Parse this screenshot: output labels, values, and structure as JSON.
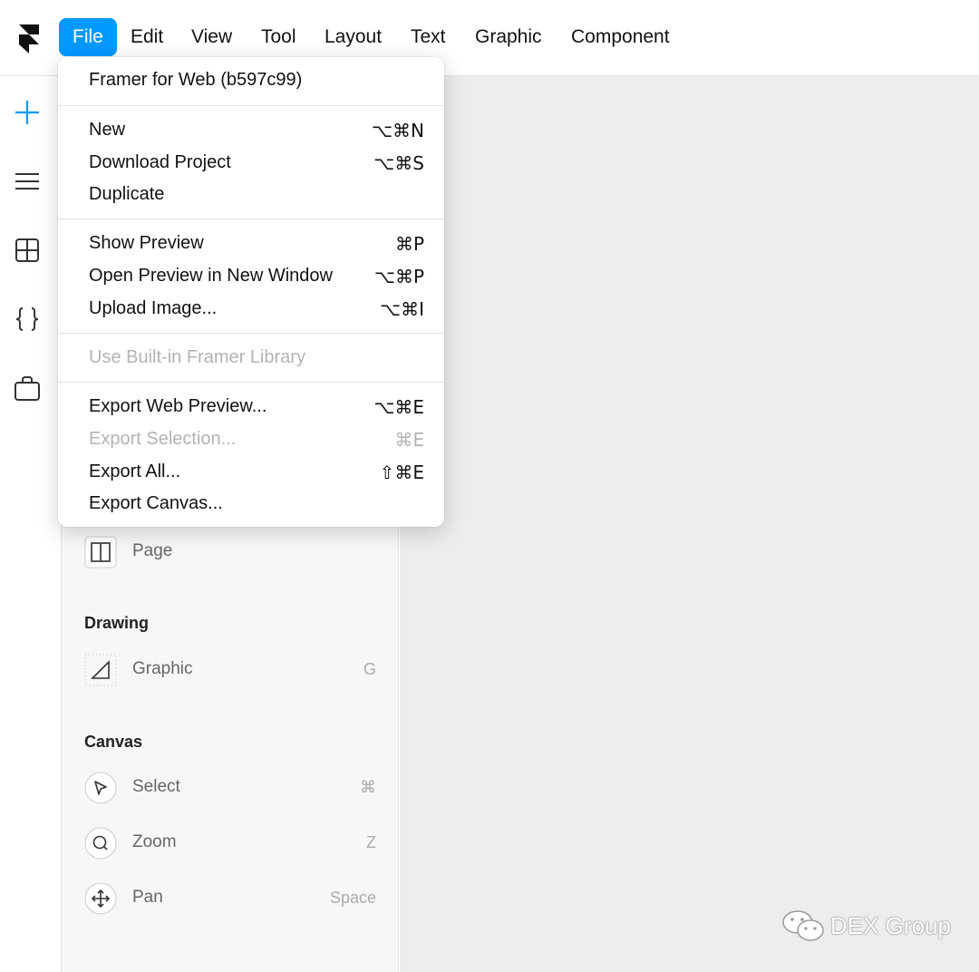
{
  "menubar": {
    "items": [
      "File",
      "Edit",
      "View",
      "Tool",
      "Layout",
      "Text",
      "Graphic",
      "Component"
    ],
    "active": "File"
  },
  "colors": {
    "accent": "#0099ff",
    "canvas": "#ededed",
    "panel": "#f7f7f7"
  },
  "rail": {
    "icons": [
      "plus-icon",
      "menu-icon",
      "grid-icon",
      "code-braces-icon",
      "bag-icon"
    ]
  },
  "file_menu": {
    "version": "Framer for Web (b597c99)",
    "new": {
      "label": "New",
      "shortcut": "⌥⌘N"
    },
    "download": {
      "label": "Download Project",
      "shortcut": "⌥⌘S"
    },
    "duplicate": {
      "label": "Duplicate"
    },
    "show_preview": {
      "label": "Show Preview",
      "shortcut": "⌘P"
    },
    "open_preview": {
      "label": "Open Preview in New Window",
      "shortcut": "⌥⌘P"
    },
    "upload_image": {
      "label": "Upload Image...",
      "shortcut": "⌥⌘I"
    },
    "builtin_library": {
      "label": "Use Built-in Framer Library"
    },
    "export_web": {
      "label": "Export Web Preview...",
      "shortcut": "⌥⌘E"
    },
    "export_selection": {
      "label": "Export Selection...",
      "shortcut": "⌘E"
    },
    "export_all": {
      "label": "Export All...",
      "shortcut": "⇧⌘E"
    },
    "export_canvas": {
      "label": "Export Canvas..."
    }
  },
  "panel": {
    "page": {
      "label": "Page"
    },
    "drawing_title": "Drawing",
    "graphic": {
      "label": "Graphic",
      "key": "G"
    },
    "canvas_title": "Canvas",
    "select": {
      "label": "Select",
      "key": "⌘"
    },
    "zoom": {
      "label": "Zoom",
      "key": "Z"
    },
    "pan": {
      "label": "Pan",
      "key": "Space"
    }
  },
  "watermark": {
    "text": "DEX Group"
  }
}
